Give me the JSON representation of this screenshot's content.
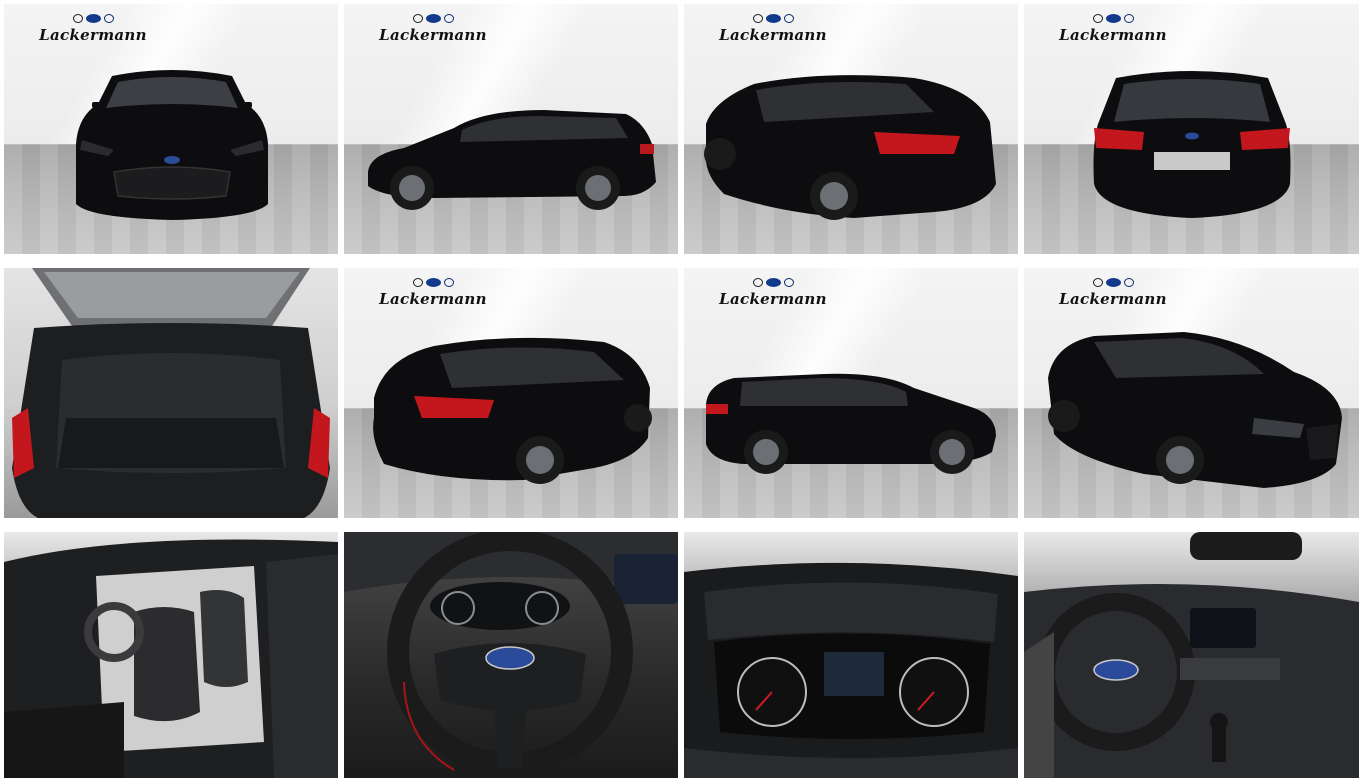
{
  "dealer": {
    "logo_text": "Lackermann",
    "brands": [
      "opel-logo-icon",
      "ford-logo-icon",
      "hyundai-logo-icon"
    ]
  },
  "vehicle": {
    "color": "#0d0d0f",
    "taillight_color": "#c3171d"
  },
  "gallery": {
    "columns": 4,
    "rows": 3,
    "photos": [
      {
        "view": "front"
      },
      {
        "view": "side-left"
      },
      {
        "view": "rear-three-quarter-right"
      },
      {
        "view": "rear"
      },
      {
        "view": "trunk-open"
      },
      {
        "view": "rear-three-quarter-left"
      },
      {
        "view": "side-right"
      },
      {
        "view": "front-three-quarter-right"
      },
      {
        "view": "interior-front-seats"
      },
      {
        "view": "steering-wheel"
      },
      {
        "view": "instrument-cluster"
      },
      {
        "view": "dashboard"
      }
    ]
  }
}
